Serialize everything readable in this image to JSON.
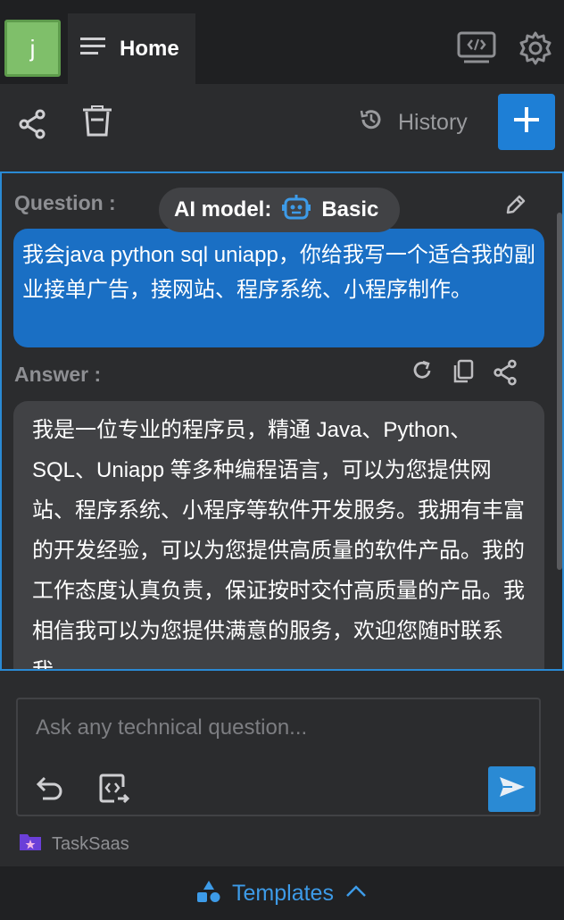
{
  "topbar": {
    "avatar_letter": "j",
    "home_tab_label": "Home",
    "icons": [
      "screen-code-icon",
      "gear-icon"
    ]
  },
  "toolbar": {
    "history_label": "History",
    "icons": [
      "share-icon",
      "trash-icon",
      "history-icon",
      "plus-icon"
    ]
  },
  "question": {
    "label": "Question :",
    "model_label": "AI model:",
    "model_value": "Basic",
    "text": "我会java python sql uniapp，你给我写一个适合我的副业接单广告，接网站、程序系统、小程序制作。"
  },
  "answer": {
    "label": "Answer :",
    "text": "我是一位专业的程序员，精通 Java、Python、SQL、Uniapp 等多种编程语言，可以为您提供网站、程序系统、小程序等软件开发服务。我拥有丰富的开发经验，可以为您提供高质量的软件产品。我的工作态度认真负责，保证按时交付高质量的产品。我相信我可以为您提供满意的服务，欢迎您随时联系我。"
  },
  "input": {
    "placeholder": "Ask any technical question..."
  },
  "brand": {
    "name": "TaskSaas"
  },
  "bottom": {
    "templates_label": "Templates"
  },
  "colors": {
    "accent": "#1e7fd6",
    "question_bubble": "#1a6fc4",
    "answer_bubble": "#414245",
    "background": "#2b2c2e",
    "avatar": "#7fbf6a",
    "templates_text": "#3d9be8"
  }
}
